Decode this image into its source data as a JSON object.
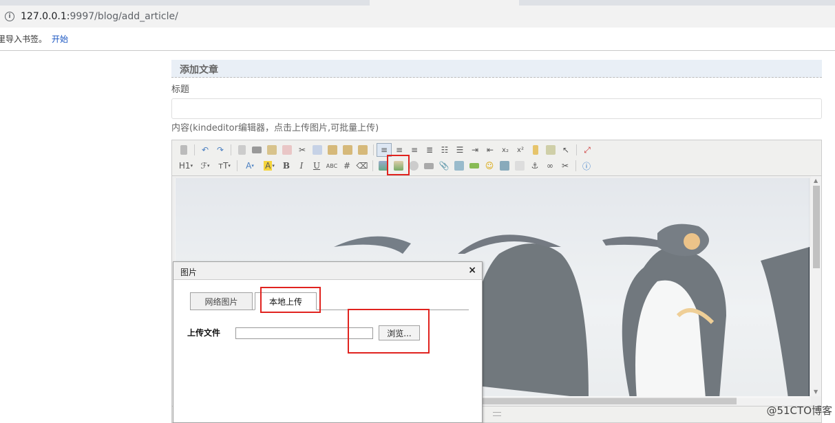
{
  "browser": {
    "url_host": "127.0.0.1:",
    "url_rest": "9997/blog/add_article/",
    "bookmark_prompt": "里导入书签。",
    "bookmark_link": "开始"
  },
  "page": {
    "section_title": "添加文章",
    "title_label": "标题",
    "content_label": "内容(kindeditor编辑器，点击上传图片,可批量上传)"
  },
  "editor": {
    "toolbar_row1": [
      "source",
      "undo",
      "redo",
      "preview",
      "print",
      "template",
      "code",
      "cut",
      "copy",
      "paste",
      "paste-text",
      "paste-word",
      "justify-left",
      "justify-center",
      "justify-right",
      "justify-full",
      "ordered-list",
      "unordered-list",
      "indent",
      "outdent",
      "subscript",
      "superscript",
      "clear-format",
      "quick-format",
      "select-all",
      "fullscreen"
    ],
    "toolbar_row2_labels": {
      "heading": "H1",
      "font": "ℱ",
      "size": "тT",
      "bold": "B",
      "italic": "I",
      "underline": "U",
      "strike": "ABC"
    },
    "image_tool_highlighted": true
  },
  "dialog": {
    "title": "图片",
    "close": "×",
    "tabs": [
      "网络图片",
      "本地上传"
    ],
    "active_tab": "本地上传",
    "upload_label": "上传文件",
    "file_value": "",
    "browse_label": "浏览..."
  },
  "watermark": "@51CTO博客",
  "colors": {
    "highlight": "#e0221e",
    "link": "#1a56c2"
  }
}
